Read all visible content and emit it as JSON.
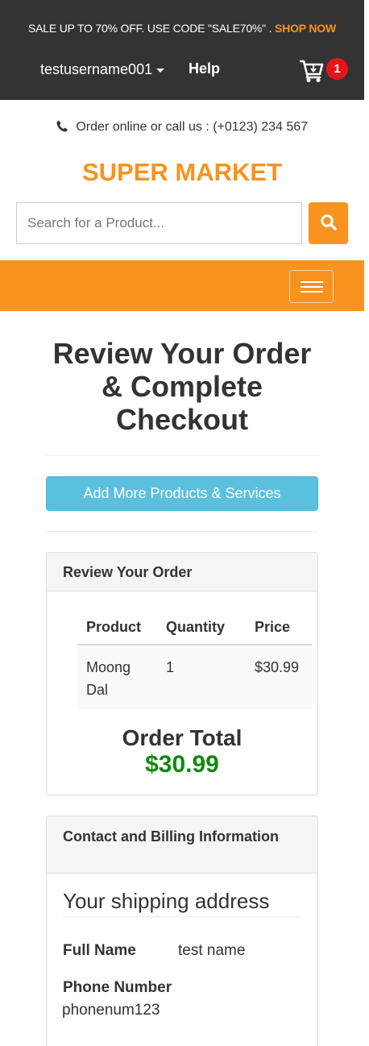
{
  "topbar": {
    "promo_text": "SALE UP TO 70% OFF. USE CODE \"SALE70%\" .",
    "promo_link": "SHOP NOW",
    "username": "testusername001",
    "help": "Help",
    "cart_count": "1",
    "cart_icon": "cart-icon"
  },
  "header": {
    "contact_text": "Order online or call us : (+0123) 234 567",
    "brand": "SUPER MARKET",
    "search_placeholder": "Search for a Product..."
  },
  "main": {
    "title": "Review Your Order & Complete Checkout",
    "add_button": "Add More Products & Services"
  },
  "order_panel": {
    "heading": "Review Your Order",
    "columns": [
      "Product",
      "Quantity",
      "Price"
    ],
    "rows": [
      {
        "product": "Moong Dal",
        "quantity": "1",
        "price": "$30.99"
      }
    ],
    "total_label": "Order Total",
    "total_value": "$30.99"
  },
  "billing_panel": {
    "heading": "Contact and Billing Information",
    "section_title": "Your shipping address",
    "full_name_label": "Full Name",
    "full_name_value": "test name",
    "phone_label": "Phone Number",
    "phone_value": "phonenum123"
  },
  "colors": {
    "accent": "#f7931e",
    "topbar": "#333333",
    "info_button": "#5bc0de",
    "total_green": "#118811",
    "badge_red": "#e8141b"
  }
}
